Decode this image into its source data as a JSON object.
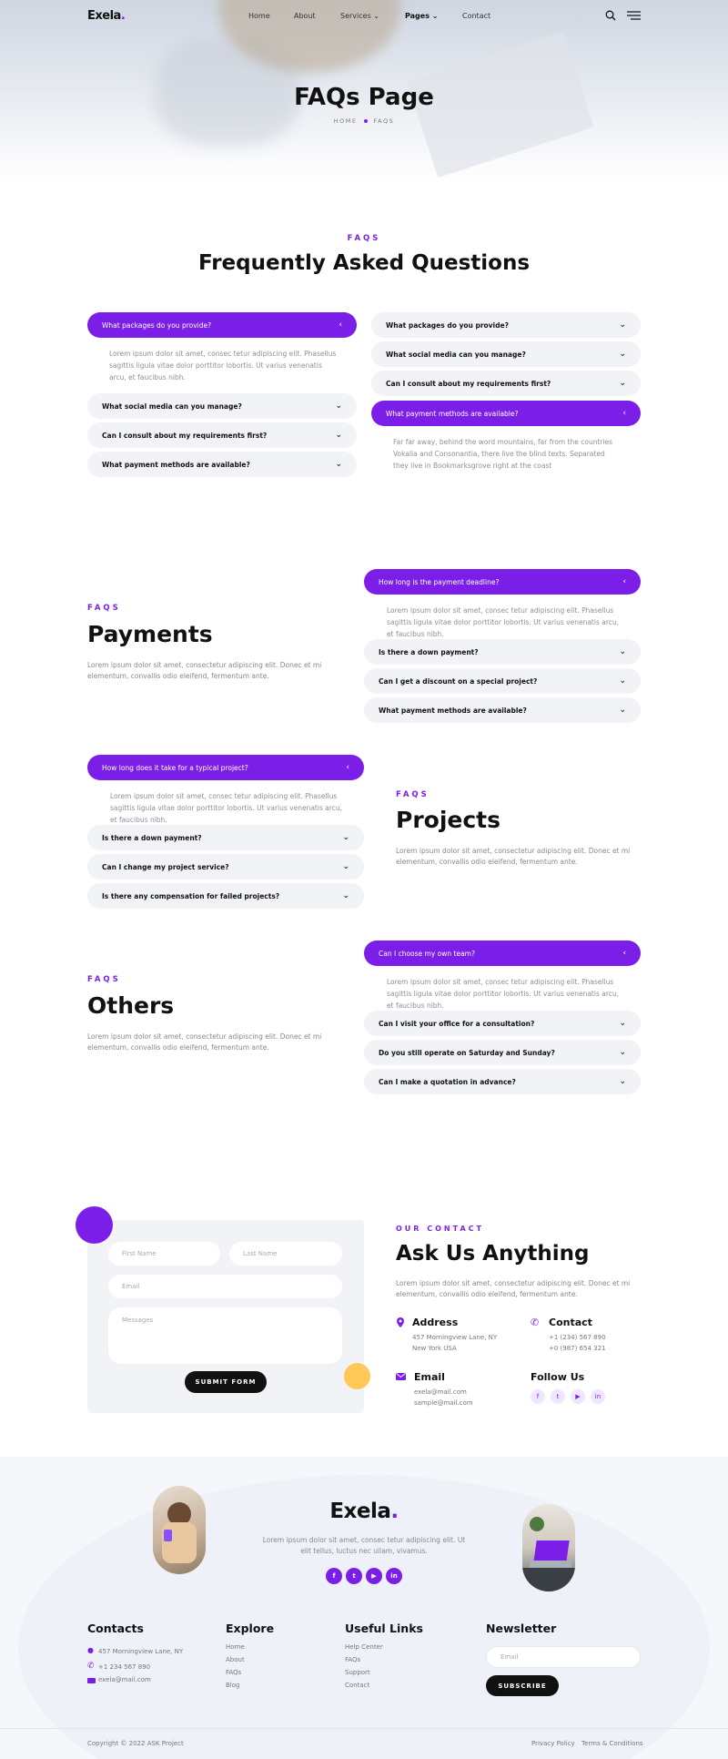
{
  "header": {
    "logo": "Exela",
    "nav": [
      "Home",
      "About",
      "Services",
      "Pages",
      "Contact"
    ],
    "icons": [
      "search-icon",
      "menu-icon"
    ]
  },
  "hero": {
    "title": "FAQs Page",
    "breadcrumb": [
      "HOME",
      "FAQS"
    ]
  },
  "faq_main": {
    "kicker": "FAQS",
    "title": "Frequently Asked Questions",
    "left": {
      "items": [
        "What packages do you provide?",
        "What social media can you manage?",
        "Can I consult about my requirements first?",
        "What payment methods are available?"
      ],
      "answer": "Lorem ipsum dolor sit amet, consec tetur adipiscing elit. Phasellus sagittis ligula vitae dolor porttitor lobortis. Ut varius venenatis arcu, et faucibus nibh."
    },
    "right": {
      "items": [
        "What packages do you provide?",
        "What social media can you manage?",
        "Can I consult about my requirements first?",
        "What payment methods are available?"
      ],
      "answer": "Far far away, behind the word mountains, far from the countries Vokalia and Consonantia, there live the blind texts. Separated they live in Bookmarksgrove right at the coast"
    }
  },
  "payments": {
    "kicker": "FAQS",
    "title": "Payments",
    "text": "Lorem ipsum dolor sit amet, consectetur adipiscing elit. Donec et mi elementum, convallis odio eleifend, fermentum ante.",
    "items": [
      "How long is the payment deadline?",
      "Is there a down payment?",
      "Can I get a discount on a special project?",
      "What payment methods are available?"
    ],
    "answer": "Lorem ipsum dolor sit amet, consec tetur adipiscing elit. Phasellus sagittis ligula vitae dolor porttitor lobortis. Ut varius venenatis arcu, et faucibus nibh."
  },
  "projects": {
    "kicker": "FAQS",
    "title": "Projects",
    "text": "Lorem ipsum dolor sit amet, consectetur adipiscing elit. Donec et mi elementum, convallis odio eleifend, fermentum ante.",
    "items": [
      "How long does it take for a typical project?",
      "Is there a down payment?",
      "Can I change my project service?",
      "Is there any compensation for failed projects?"
    ],
    "answer": "Lorem ipsum dolor sit amet, consec tetur adipiscing elit. Phasellus sagittis ligula vitae dolor porttitor lobortis. Ut varius venenatis arcu, et faucibus nibh."
  },
  "others": {
    "kicker": "FAQS",
    "title": "Others",
    "text": "Lorem ipsum dolor sit amet, consectetur adipiscing elit. Donec et mi elementum, convallis odio eleifend, fermentum ante.",
    "items": [
      "Can I choose my own team?",
      "Can I visit your office for a consultation?",
      "Do you still operate on Saturday and Sunday?",
      "Can I make a quotation in advance?"
    ],
    "answer": "Lorem ipsum dolor sit amet, consec tetur adipiscing elit. Phasellus sagittis ligula vitae dolor porttitor lobortis. Ut varius venenatis arcu, et faucibus nibh."
  },
  "contact": {
    "form": {
      "first_name": "First Name",
      "last_name": "Last Name",
      "email": "Email",
      "message": "Messages",
      "submit": "SUBMIT FORM"
    },
    "kicker": "OUR CONTACT",
    "title": "Ask Us Anything",
    "text": "Lorem ipsum dolor sit amet, consectetur adipiscing elit. Donec et mi elementum, convallis odio eleifend, fermentum ante.",
    "address": {
      "label": "Address",
      "lines": [
        "457 Morningview Lane, NY",
        "New York USA"
      ]
    },
    "phone": {
      "label": "Contact",
      "lines": [
        "+1 (234) 567 890",
        "+0 (987) 654 321"
      ]
    },
    "email": {
      "label": "Email",
      "lines": [
        "exela@mail.com",
        "sample@mail.com"
      ]
    },
    "follow": {
      "label": "Follow Us"
    }
  },
  "footer": {
    "logo": "Exela",
    "tagline": "Lorem ipsum dolor sit amet, consec tetur adipiscing elit. Ut elit tellus, luctus nec ullam, vivamus.",
    "contacts": {
      "title": "Contacts",
      "address": "457 Morningview Lane, NY",
      "phone": "+1 234 567 890",
      "email": "exela@mail.com"
    },
    "explore": {
      "title": "Explore",
      "links": [
        "Home",
        "About",
        "FAQs",
        "Blog"
      ]
    },
    "useful": {
      "title": "Useful Links",
      "links": [
        "Help Center",
        "FAQs",
        "Support",
        "Contact"
      ]
    },
    "newsletter": {
      "title": "Newsletter",
      "placeholder": "Email",
      "button": "SUBSCRIBE"
    },
    "copyright": "Copyright © 2022 ASK Project",
    "legal": [
      "Privacy Policy",
      "Terms & Conditions"
    ]
  },
  "colors": {
    "accent": "#7b1fe8",
    "yellow": "#ffc857",
    "dark": "#111111"
  }
}
